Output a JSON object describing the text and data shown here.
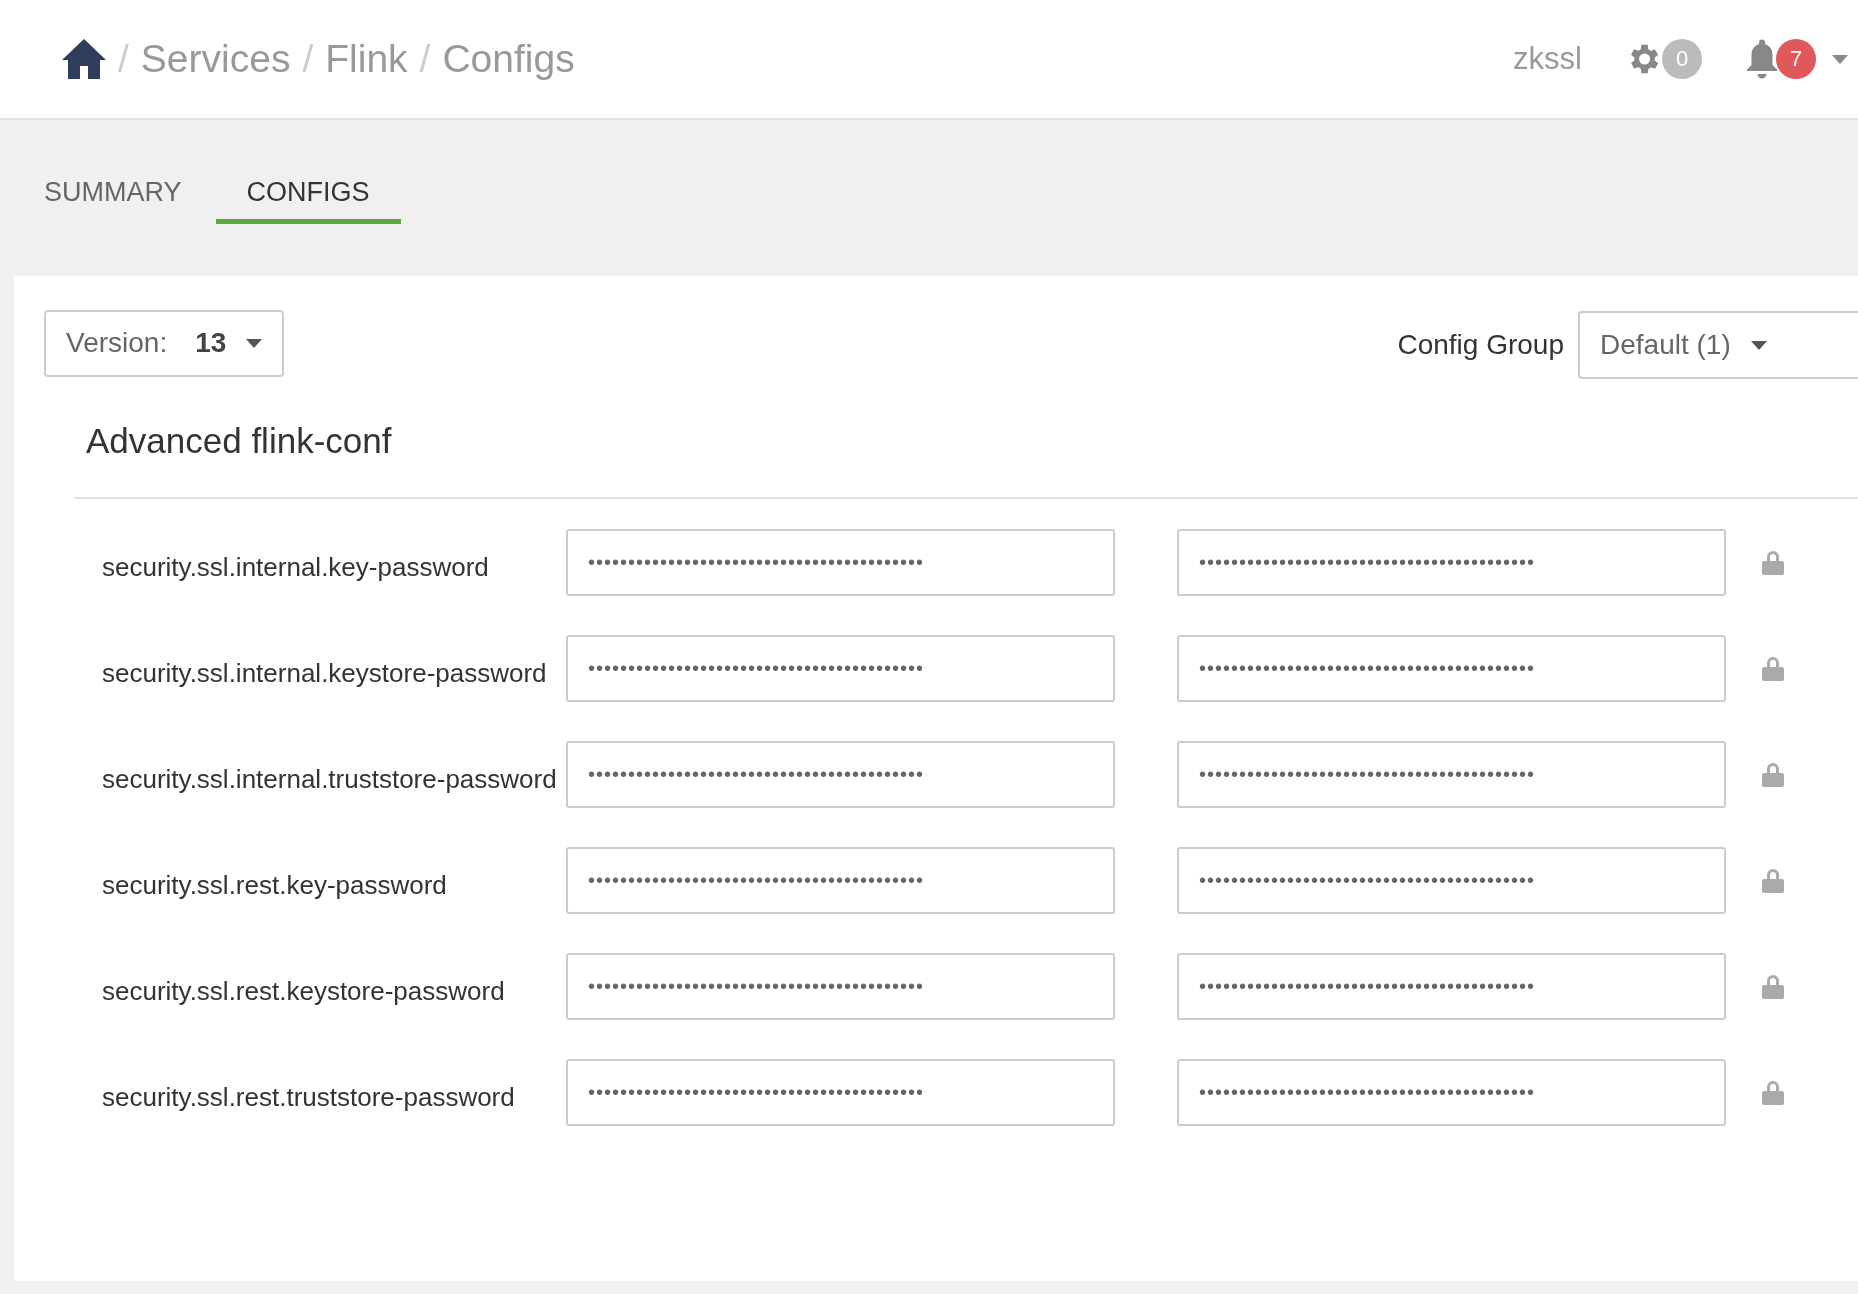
{
  "breadcrumb": {
    "items": [
      "Services",
      "Flink",
      "Configs"
    ],
    "separator": "/"
  },
  "header": {
    "user": "zkssl",
    "settings_count": "0",
    "alerts_count": "7"
  },
  "tabs": [
    {
      "label": "SUMMARY",
      "selected": false
    },
    {
      "label": "CONFIGS",
      "selected": true
    }
  ],
  "version": {
    "label": "Version:",
    "value": "13"
  },
  "config_group": {
    "label": "Config Group",
    "value": "Default (1)"
  },
  "section": {
    "title": "Advanced flink-conf",
    "rows": [
      {
        "name": "security.ssl.internal.key-password",
        "value": "••••••••••••••••••••••••••••••••••••••••••",
        "compare_value": "••••••••••••••••••••••••••••••••••••••••••"
      },
      {
        "name": "security.ssl.internal.keystore-password",
        "value": "••••••••••••••••••••••••••••••••••••••••••",
        "compare_value": "••••••••••••••••••••••••••••••••••••••••••"
      },
      {
        "name": "security.ssl.internal.truststore-password",
        "value": "••••••••••••••••••••••••••••••••••••••••••",
        "compare_value": "••••••••••••••••••••••••••••••••••••••••••"
      },
      {
        "name": "security.ssl.rest.key-password",
        "value": "••••••••••••••••••••••••••••••••••••••••••",
        "compare_value": "••••••••••••••••••••••••••••••••••••••••••"
      },
      {
        "name": "security.ssl.rest.keystore-password",
        "value": "••••••••••••••••••••••••••••••••••••••••••",
        "compare_value": "••••••••••••••••••••••••••••••••••••••••••"
      },
      {
        "name": "security.ssl.rest.truststore-password",
        "value": "••••••••••••••••••••••••••••••••••••••••••",
        "compare_value": "••••••••••••••••••••••••••••••••••••••••••"
      }
    ]
  }
}
